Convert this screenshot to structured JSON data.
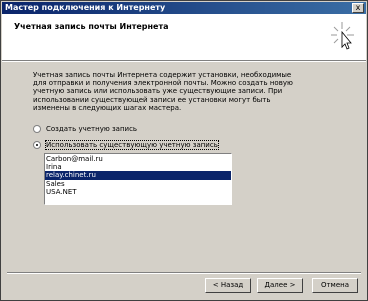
{
  "window": {
    "title": "Мастер подключения к Интернету",
    "close_label": "x"
  },
  "header": {
    "title": "Учетная запись почты Интернета",
    "icon": "wizard-sparkle-icon"
  },
  "description": "Учетная запись почты Интернета содержит установки, необходимые для отправки и получения электронной почты. Можно создать новую учетную запись или использовать уже существующие записи. При использовании существующей записи ее установки могут быть изменены в следующих шагах мастера.",
  "options": {
    "create": {
      "label": "Создать учетную запись",
      "checked": false
    },
    "use_existing": {
      "label": "Использовать существующую учетную запись",
      "checked": true
    }
  },
  "accounts": {
    "items": [
      "Carbon@mail.ru",
      "Irina",
      "relay.chinet.ru",
      "Sales",
      "USA.NET"
    ],
    "selected": "relay.chinet.ru"
  },
  "buttons": {
    "back": "< Назад",
    "next": "Далее >",
    "cancel": "Отмена"
  }
}
